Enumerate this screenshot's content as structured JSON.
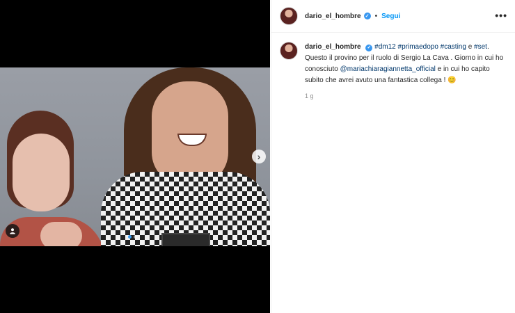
{
  "post": {
    "username": "dario_el_hombre",
    "verified": true,
    "follow_label": "Segui",
    "bullet": "•",
    "more_icon": "more-horizontal-icon"
  },
  "caption": {
    "username": "dario_el_hombre",
    "hashtags": [
      "#dm12",
      "#primaedopo",
      "#casting",
      "#set"
    ],
    "connector": "e",
    "line1": "Questo il provino per il ruolo di Sergio La Cava . Giorno in cui ho conosciuto",
    "mention": "@mariachiaragiannetta_official",
    "line2": "e in cui ho capito subito che avrei avuto una fantastica collega !",
    "emoji": "😊",
    "timestamp": "1 g"
  },
  "media": {
    "next_icon": "chevron-right-icon",
    "tag_icon": "user-tag-icon",
    "carousel_count": 2,
    "carousel_active": 0
  },
  "colors": {
    "accent": "#0095f6",
    "hashtag": "#00376b",
    "verified": "#3897f0"
  }
}
